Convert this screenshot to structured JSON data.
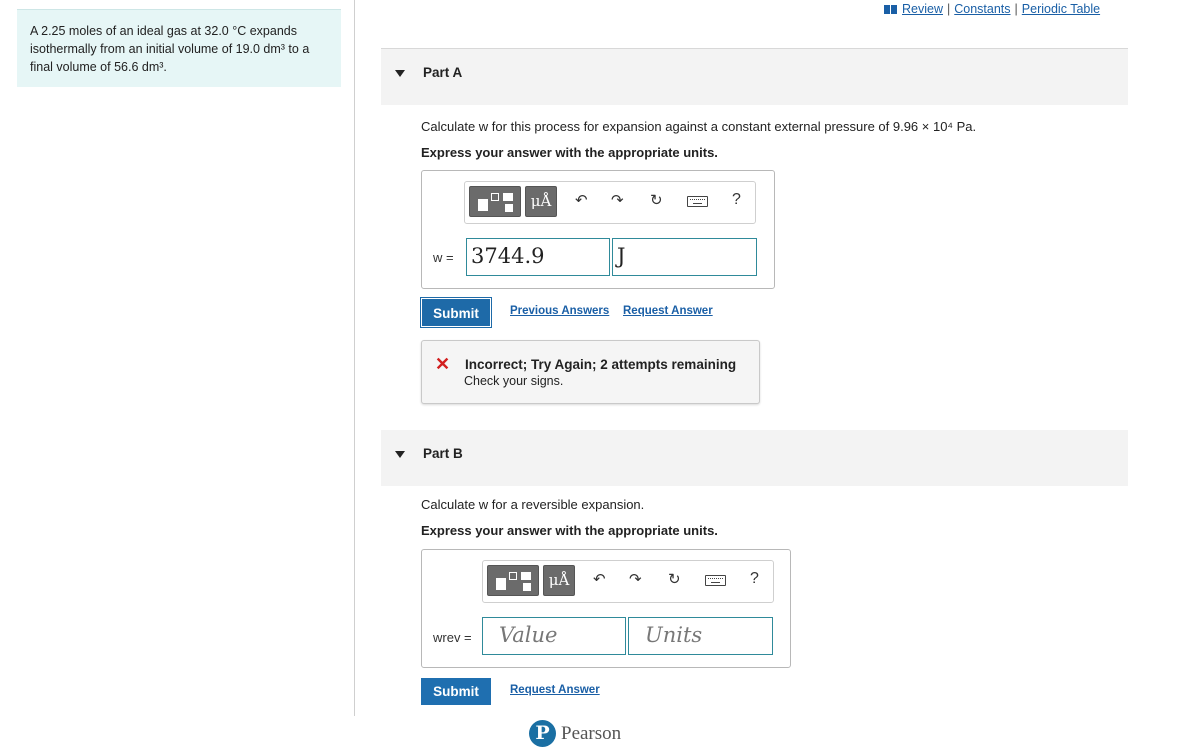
{
  "problem": {
    "line1": "A 2.25 moles of an ideal gas at 32.0 °C expands",
    "line2": "isothermally from an initial volume of 19.0 dm³ to a",
    "line3": "final volume of 56.6 dm³."
  },
  "top_links": {
    "review": "Review",
    "constants": "Constants",
    "periodic_table": "Periodic Table",
    "separator": "|"
  },
  "part_a": {
    "title": "Part A",
    "question": "Calculate w for this process for expansion against a constant external pressure of 9.96 × 10⁴ Pa.",
    "instruction": "Express your answer with the appropriate units.",
    "toolbar": {
      "units_label": "μÅ",
      "undo": "↶",
      "redo": "↷",
      "reset": "↻",
      "help": "?"
    },
    "answer_label": "w =",
    "value": "3744.9",
    "units": "J",
    "submit": "Submit",
    "previous_answers": "Previous Answers",
    "request_answer": "Request Answer",
    "feedback": {
      "icon": "✕",
      "title": "Incorrect; Try Again; 2 attempts remaining",
      "message": "Check your signs."
    }
  },
  "part_b": {
    "title": "Part B",
    "question": "Calculate w for a reversible expansion.",
    "instruction": "Express your answer with the appropriate units.",
    "toolbar": {
      "units_label": "μÅ",
      "undo": "↶",
      "redo": "↷",
      "reset": "↻",
      "help": "?"
    },
    "answer_label": "wrev =",
    "value_placeholder": "Value",
    "units_placeholder": "Units",
    "submit": "Submit",
    "request_answer": "Request Answer"
  },
  "footer": {
    "logo_letter": "P",
    "brand": "Pearson"
  },
  "colors": {
    "accent": "#1e6aa8",
    "error": "#d21f1f",
    "problem_bg": "#e6f6f6"
  }
}
